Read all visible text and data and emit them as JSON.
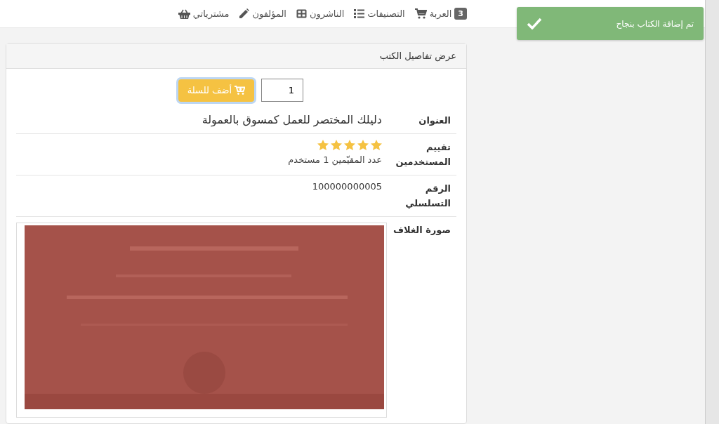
{
  "navbar": {
    "items": [
      {
        "label": "العربة",
        "badge": "3"
      },
      {
        "label": "التصنيفات"
      },
      {
        "label": "الناشرون"
      },
      {
        "label": "المؤلفون"
      },
      {
        "label": "مشترياتي"
      }
    ]
  },
  "toast": {
    "message": "تم إضافة الكتاب بنجاح"
  },
  "panel": {
    "title": "عرض تفاصيل الكتب",
    "quantity": {
      "value": "1"
    },
    "add_button": "أضف للسلة",
    "rows": [
      {
        "kind": "text",
        "label": "العنوان",
        "value": "دليلك المختصر للعمل كمسوق بالعمولة"
      },
      {
        "kind": "rating",
        "label": "تقييم المستخدمين",
        "stars": 5,
        "count_text": "عدد المقيّمين 1 مستخدم"
      },
      {
        "kind": "serial",
        "label": "الرقم التسلسلي",
        "value": "100000000005"
      },
      {
        "kind": "picture",
        "label": "صورة الغلاف"
      }
    ]
  }
}
